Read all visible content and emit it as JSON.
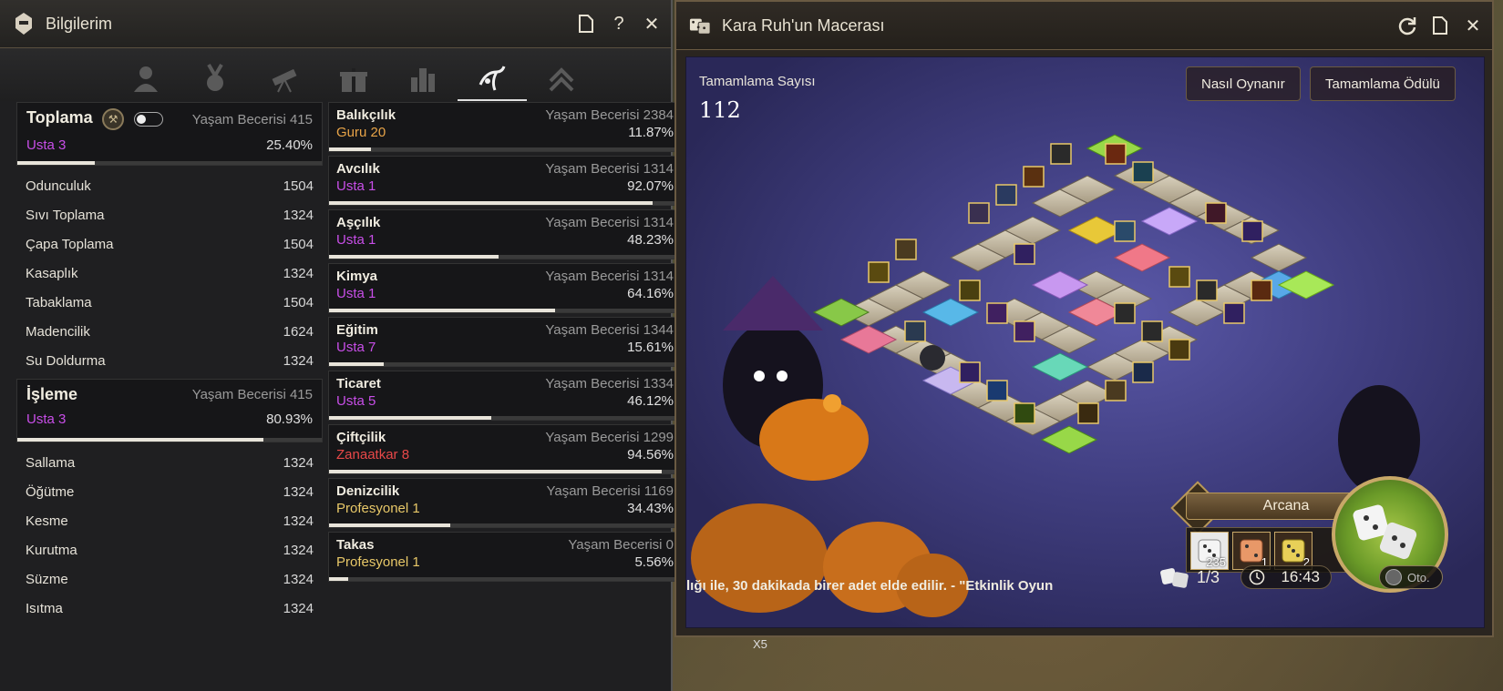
{
  "left_window": {
    "title": "Bilgilerim",
    "buttons": {
      "doc": "doc-icon",
      "help": "?",
      "close": "✕"
    },
    "tabs": [
      "person-icon",
      "medal-icon",
      "telescope-icon",
      "gift-icon",
      "bars-icon",
      "fishing-icon",
      "chevrons-icon"
    ],
    "gathering": {
      "title": "Toplama",
      "skill_label": "Yaşam Becerisi 415",
      "rank": "Usta 3",
      "percent": "25.40%",
      "progress": 0.254,
      "items": [
        {
          "name": "Odunculuk",
          "value": "1504"
        },
        {
          "name": "Sıvı Toplama",
          "value": "1324"
        },
        {
          "name": "Çapa Toplama",
          "value": "1504"
        },
        {
          "name": "Kasaplık",
          "value": "1324"
        },
        {
          "name": "Tabaklama",
          "value": "1504"
        },
        {
          "name": "Madencilik",
          "value": "1624"
        },
        {
          "name": "Su Doldurma",
          "value": "1324"
        }
      ]
    },
    "processing": {
      "title": "İşleme",
      "skill_label": "Yaşam Becerisi 415",
      "rank": "Usta 3",
      "percent": "80.93%",
      "progress": 0.8093,
      "items": [
        {
          "name": "Sallama",
          "value": "1324"
        },
        {
          "name": "Öğütme",
          "value": "1324"
        },
        {
          "name": "Kesme",
          "value": "1324"
        },
        {
          "name": "Kurutma",
          "value": "1324"
        },
        {
          "name": "Süzme",
          "value": "1324"
        },
        {
          "name": "Isıtma",
          "value": "1324"
        }
      ]
    },
    "skills": [
      {
        "name": "Balıkçılık",
        "ls": "Yaşam Becerisi 2384",
        "rank": "Guru 20",
        "rank_color": "orange",
        "percent": "11.87%",
        "progress": 0.1187
      },
      {
        "name": "Avcılık",
        "ls": "Yaşam Becerisi 1314",
        "rank": "Usta 1",
        "rank_color": "purple",
        "percent": "92.07%",
        "progress": 0.9207
      },
      {
        "name": "Aşçılık",
        "ls": "Yaşam Becerisi 1314",
        "rank": "Usta 1",
        "rank_color": "purple",
        "percent": "48.23%",
        "progress": 0.4823
      },
      {
        "name": "Kimya",
        "ls": "Yaşam Becerisi 1314",
        "rank": "Usta 1",
        "rank_color": "purple",
        "percent": "64.16%",
        "progress": 0.6416
      },
      {
        "name": "Eğitim",
        "ls": "Yaşam Becerisi 1344",
        "rank": "Usta 7",
        "rank_color": "purple",
        "percent": "15.61%",
        "progress": 0.1561
      },
      {
        "name": "Ticaret",
        "ls": "Yaşam Becerisi 1334",
        "rank": "Usta 5",
        "rank_color": "purple",
        "percent": "46.12%",
        "progress": 0.4612
      },
      {
        "name": "Çiftçilik",
        "ls": "Yaşam Becerisi 1299",
        "rank": "Zanaatkar 8",
        "rank_color": "red",
        "percent": "94.56%",
        "progress": 0.9456
      },
      {
        "name": "Denizcilik",
        "ls": "Yaşam Becerisi 1169",
        "rank": "Profesyonel 1",
        "rank_color": "gold",
        "percent": "34.43%",
        "progress": 0.3443
      },
      {
        "name": "Takas",
        "ls": "Yaşam Becerisi 0",
        "rank": "Profesyonel 1",
        "rank_color": "gold",
        "percent": "5.56%",
        "progress": 0.0556
      }
    ]
  },
  "right_window": {
    "title": "Kara Ruh'un Macerası",
    "buttons": {
      "refresh": "refresh-icon",
      "doc": "doc-icon",
      "close": "✕"
    },
    "count_label": "Tamamlama Sayısı",
    "count_value": "112",
    "how_to_play": "Nasıl Oynanır",
    "completion_reward": "Tamamlama Ödülü",
    "arcana_label": "Arcana",
    "dice": [
      {
        "type": "white",
        "qty": "235"
      },
      {
        "type": "orange",
        "qty": "1"
      },
      {
        "type": "yellow",
        "qty": "2"
      }
    ],
    "ticker": "lığı ile, 30 dakikada birer adet elde edilir. - \"Etkinlik Oyun",
    "rolls": "1/3",
    "timer": "16:43",
    "auto_label": "Oto."
  },
  "background": {
    "bottom_badge": "X5"
  },
  "colors": {
    "purple": "#c84ee8",
    "orange": "#e8a448",
    "red": "#e84848",
    "gold": "#e8c868"
  }
}
